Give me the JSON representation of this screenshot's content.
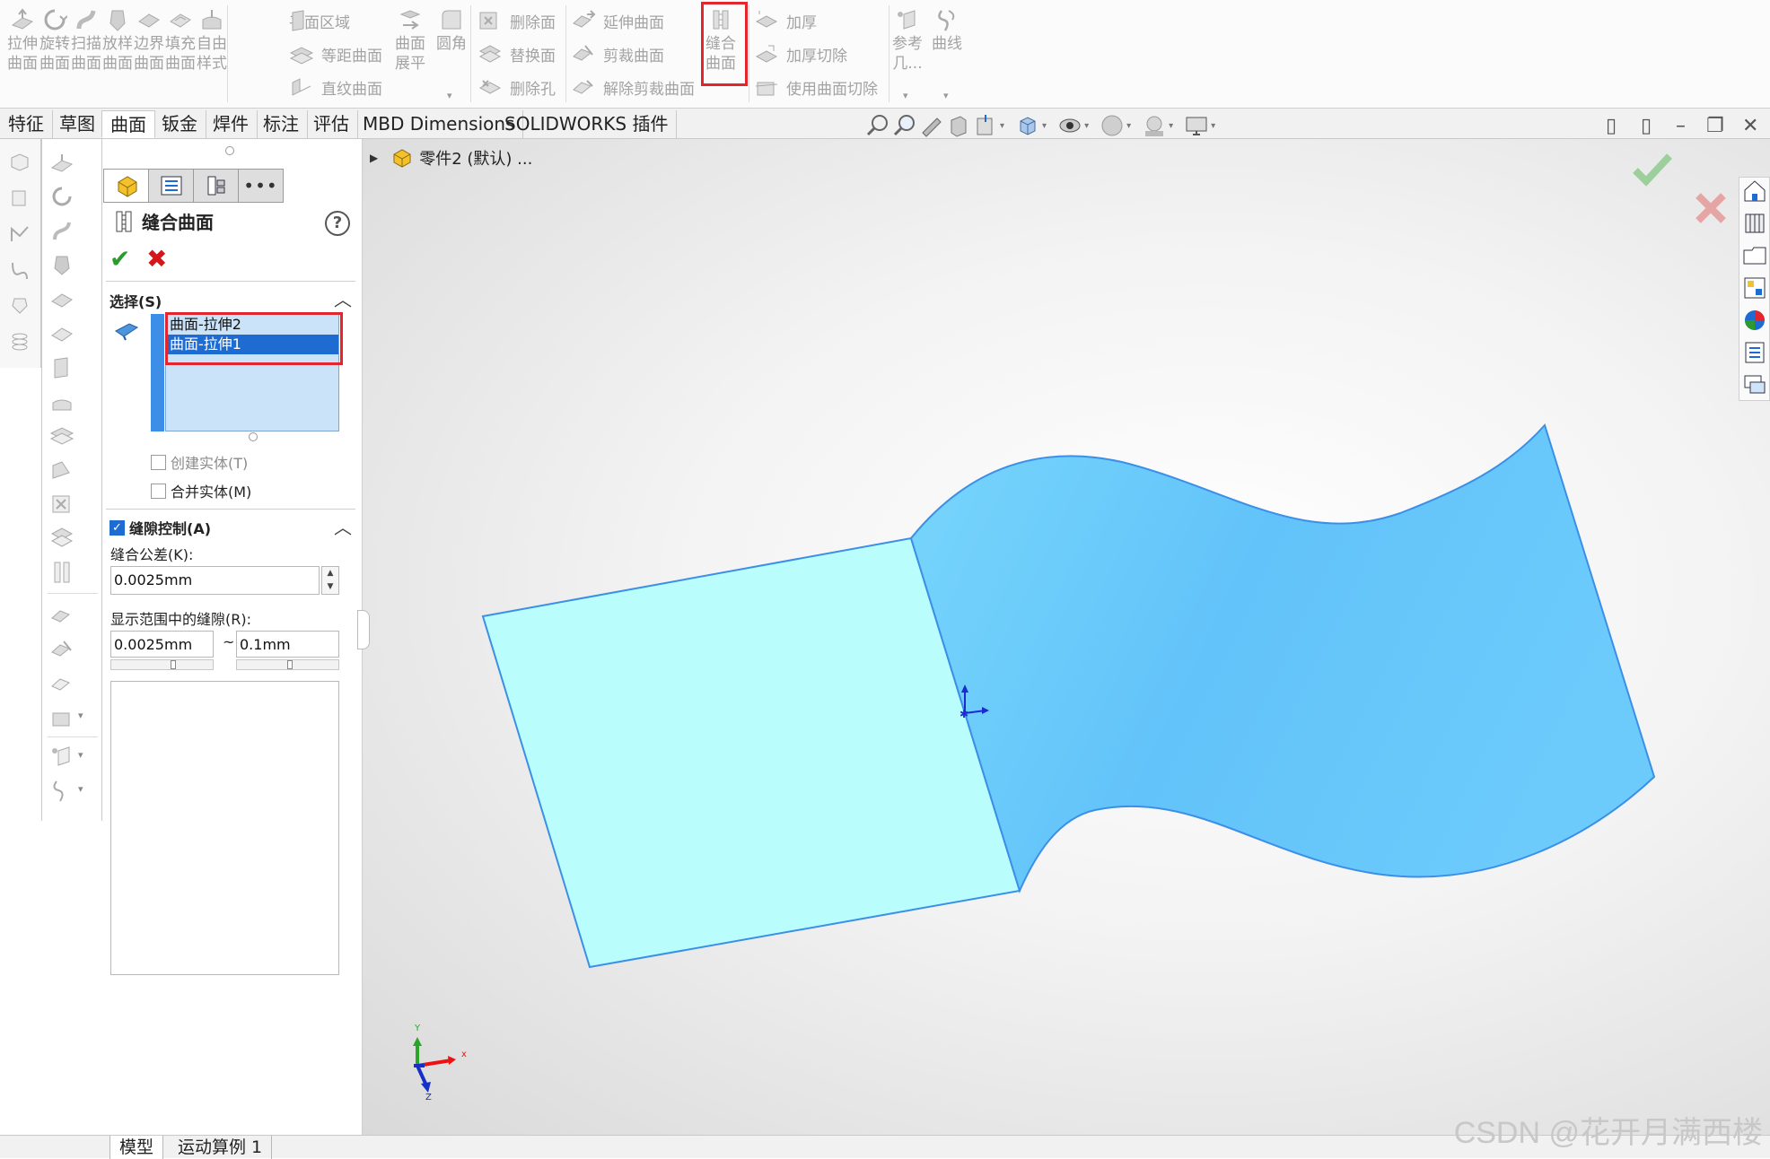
{
  "ribbon": {
    "group1": [
      {
        "l1": "拉伸",
        "l2": "曲面"
      },
      {
        "l1": "旋转",
        "l2": "曲面"
      },
      {
        "l1": "扫描",
        "l2": "曲面"
      },
      {
        "l1": "放样",
        "l2": "曲面"
      },
      {
        "l1": "边界",
        "l2": "曲面"
      },
      {
        "l1": "填充",
        "l2": "曲面"
      },
      {
        "l1": "自由",
        "l2": "样式"
      }
    ],
    "planar": "平面区域",
    "offset": "等距曲面",
    "ruled": "直纹曲面",
    "flatten_l1": "曲面",
    "flatten_l2": "展平",
    "fillet": "圆角",
    "delete_face": "删除面",
    "replace_face": "替换面",
    "delete_hole": "删除孔",
    "extend": "延伸曲面",
    "trim": "剪裁曲面",
    "untrim": "解除剪裁曲面",
    "knit_l1": "缝合",
    "knit_l2": "曲面",
    "thicken": "加厚",
    "thicken_cut": "加厚切除",
    "cut_with_surface": "使用曲面切除",
    "ref_l1": "参考",
    "ref_l2": "几...",
    "curves": "曲线"
  },
  "tabs": [
    "特征",
    "草图",
    "曲面",
    "钣金",
    "焊件",
    "标注",
    "评估",
    "MBD Dimensions",
    "SOLIDWORKS 插件"
  ],
  "active_tab": "曲面",
  "panel": {
    "title": "缝合曲面",
    "help": "?",
    "ok_symbol": "✔",
    "cancel_symbol": "✖",
    "selection_header": "选择(S)",
    "selections": [
      "曲面-拉伸2",
      "曲面-拉伸1"
    ],
    "selected_index": 1,
    "create_solid": "创建实体(T)",
    "merge_entities": "合并实体(M)",
    "gap_control": "缝隙控制(A)",
    "knit_tolerance_label": "缝合公差(K):",
    "knit_tolerance": "0.0025mm",
    "gap_range_label": "显示范围中的缝隙(R):",
    "gap_min": "0.0025mm",
    "gap_sep": "~",
    "gap_max": "0.1mm"
  },
  "tree": {
    "part": "零件2 (默认) ..."
  },
  "triad": {
    "x": "x",
    "y": "Y",
    "z": "Z"
  },
  "bottom_tabs": [
    "模型",
    "运动算例 1"
  ],
  "watermark": "CSDN @花开月满西楼",
  "colors": {
    "accent": "#1e6bd1",
    "highlight": "#e3262e",
    "surface_flat": "#b9fdfd",
    "surface_wave": "#66c9fb",
    "edge": "#3b8fe6"
  }
}
